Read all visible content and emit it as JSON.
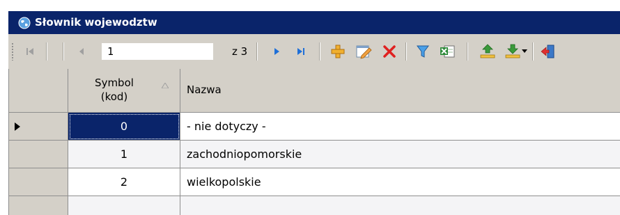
{
  "window": {
    "title": "Słownik wojewodztw"
  },
  "navigator": {
    "position": "1",
    "of_label": "z 3"
  },
  "icons": {
    "title": "globe-icon",
    "first": "first-record-icon",
    "prev": "previous-record-icon",
    "next": "next-record-icon",
    "last": "last-record-icon",
    "add": "add-icon",
    "edit": "edit-icon",
    "delete": "delete-icon",
    "filter": "filter-icon",
    "excel": "excel-export-icon",
    "export": "export-icon",
    "import": "import-icon",
    "exit": "exit-icon"
  },
  "colors": {
    "title_bar": "#0a246a",
    "toolbar": "#d4d0c8",
    "selection": "#0a246a",
    "delete": "#e02020",
    "add": "#e8a020"
  },
  "grid": {
    "columns": [
      {
        "label": "Symbol\n(kod)",
        "sorted": "ascending"
      },
      {
        "label": "Nazwa"
      }
    ],
    "rows": [
      {
        "symbol": "0",
        "name": "- nie dotyczy -",
        "selected": true
      },
      {
        "symbol": "1",
        "name": "zachodniopomorskie"
      },
      {
        "symbol": "2",
        "name": "wielkopolskie"
      }
    ]
  }
}
